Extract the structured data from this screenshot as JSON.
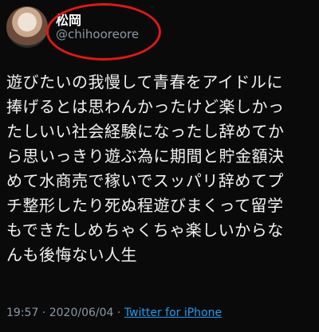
{
  "profile": {
    "display_name": "松岡",
    "handle": "@chihooreore"
  },
  "tweet": {
    "text": "遊びたいの我慢して青春をアイドルに\n捧げるとは思わんかったけど楽しかっ\nたしいい社会経験になったし辞めてか\nら思いっきり遊ぶ為に期間と貯金額決\nめて水商売で稼いでスッパリ辞めてプ\nチ整形したり死ぬ程遊びまくって留学\nもできたしめちゃくちゃ楽しいからな\nんも後悔ない人生"
  },
  "meta": {
    "time": "19:57",
    "separator": " · ",
    "date": "2020/06/04",
    "separator2": " · ",
    "client": "Twitter for iPhone"
  },
  "colors": {
    "background": "#0a0a0a",
    "handle": "#8b98a5",
    "link": "#1d9bf0",
    "annotation": "#e01818"
  }
}
